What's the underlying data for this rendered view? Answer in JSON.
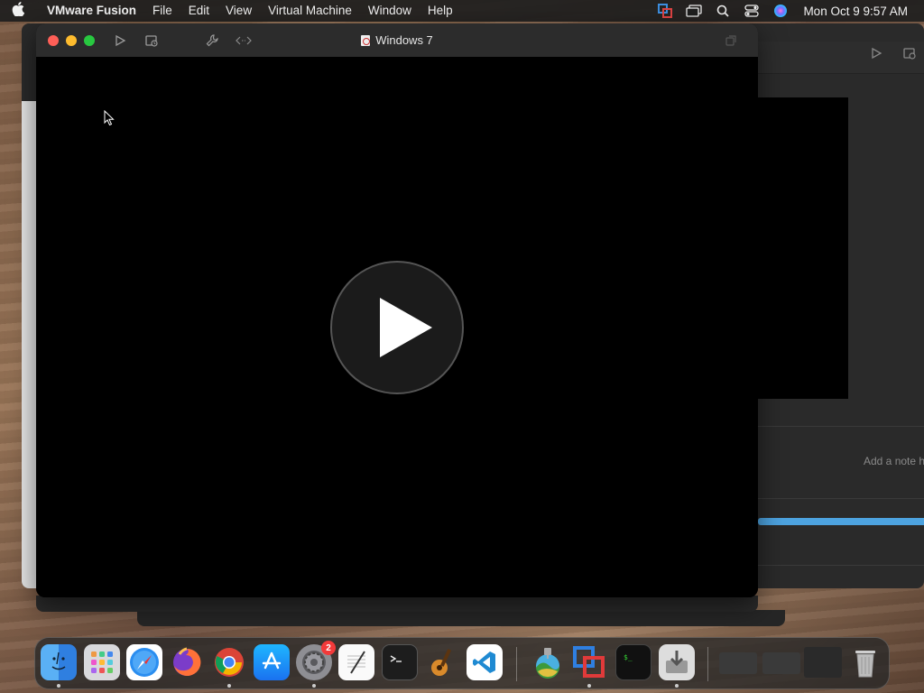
{
  "menubar": {
    "app_name": "VMware Fusion",
    "menus": [
      "File",
      "Edit",
      "View",
      "Virtual Machine",
      "Window",
      "Help"
    ],
    "clock": "Mon Oct 9  9:57 AM",
    "status_icons": [
      "vmware-status-icon",
      "screen-mirror-icon",
      "spotlight-search-icon",
      "control-center-icon",
      "siri-icon"
    ]
  },
  "vm_window": {
    "title": "Windows 7",
    "toolbar_icons": [
      "play-icon",
      "snapshot-icon",
      "settings-wrench-icon",
      "code-brackets-icon",
      "fullscreen-icon"
    ],
    "screen_state": "powered-off",
    "play_button_icon": "play-icon"
  },
  "library_window": {
    "note_placeholder": "Add a note h",
    "progress": 1.0,
    "progress_color": "#4da3e0"
  },
  "dock": {
    "apps": [
      {
        "name": "Finder",
        "icon": "finder-icon",
        "running": true
      },
      {
        "name": "Launchpad",
        "icon": "launchpad-icon",
        "running": false
      },
      {
        "name": "Safari",
        "icon": "safari-icon",
        "running": false
      },
      {
        "name": "Firefox",
        "icon": "firefox-icon",
        "running": false
      },
      {
        "name": "Google Chrome",
        "icon": "chrome-icon",
        "running": true
      },
      {
        "name": "App Store",
        "icon": "app-store-icon",
        "running": false
      },
      {
        "name": "System Settings",
        "icon": "system-settings-icon",
        "running": true,
        "badge": "2"
      },
      {
        "name": "TextEdit",
        "icon": "textedit-icon",
        "running": false
      },
      {
        "name": "Terminal",
        "icon": "terminal-icon",
        "running": false
      },
      {
        "name": "GarageBand",
        "icon": "garageband-icon",
        "running": false
      },
      {
        "name": "Visual Studio Code",
        "icon": "vscode-icon",
        "running": false
      },
      {
        "name": "macOS Installer",
        "icon": "macos-installer-icon",
        "running": false
      },
      {
        "name": "VMware Fusion",
        "icon": "vmware-fusion-icon",
        "running": true
      },
      {
        "name": "Terminal",
        "icon": "terminal-green-icon",
        "running": false
      },
      {
        "name": "Installer",
        "icon": "installer-icon",
        "running": true
      }
    ],
    "minimized": [
      "minimized-window-1",
      "minimized-window-2",
      "minimized-window-3"
    ],
    "trash_icon": "trash-icon"
  },
  "colors": {
    "menubar_bg": "#1e1e1e",
    "window_bg": "#000000",
    "titlebar_bg": "#2c2c2c",
    "traffic_close": "#fe5f57",
    "traffic_min": "#febc2e",
    "traffic_max": "#28c840"
  }
}
